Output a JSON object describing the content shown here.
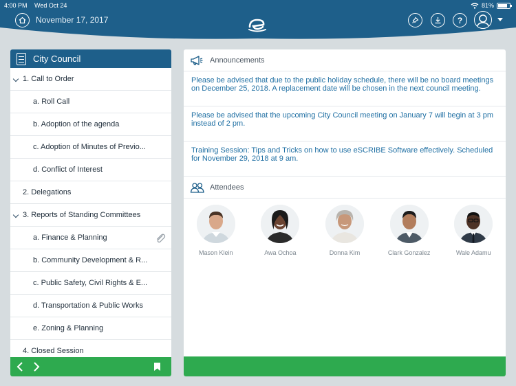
{
  "status_bar": {
    "time": "4:00 PM",
    "day": "Wed Oct 24",
    "battery": "81%"
  },
  "header": {
    "date": "November 17, 2017"
  },
  "agenda": {
    "title": "City Council",
    "items": [
      {
        "label": "1. Call to Order"
      },
      {
        "label": "a. Roll Call"
      },
      {
        "label": "b. Adoption of the agenda"
      },
      {
        "label": "c. Adoption of Minutes of Previo..."
      },
      {
        "label": "d. Conflict of Interest"
      },
      {
        "label": "2. Delegations"
      },
      {
        "label": "3. Reports of Standing Committees"
      },
      {
        "label": "a. Finance & Planning"
      },
      {
        "label": "b. Community Development & R..."
      },
      {
        "label": "c. Public Safety, Civil Rights & E..."
      },
      {
        "label": "d. Transportation & Public Works"
      },
      {
        "label": "e. Zoning & Planning"
      },
      {
        "label": "4. Closed Session"
      }
    ]
  },
  "announcements": {
    "title": "Announcements",
    "items": [
      {
        "text": "Please be advised that due to the public holiday schedule, there will be no board meetings on December 25, 2018. A replacement date will be chosen in the next council meeting."
      },
      {
        "text": "Please be advised that the upcoming City Council meeting on January 7 will begin at 3 pm instead of 2 pm."
      },
      {
        "text": "Training Session: Tips and Tricks on how to use eSCRIBE Software effectively. Scheduled for November 29, 2018 at 9 am."
      }
    ]
  },
  "attendees": {
    "title": "Attendees",
    "people": [
      {
        "name": "Mason Klein"
      },
      {
        "name": "Awa Ochoa"
      },
      {
        "name": "Donna Kim"
      },
      {
        "name": "Clark Gonzalez"
      },
      {
        "name": "Wale Adamu"
      }
    ]
  },
  "colors": {
    "header": "#1e5f8a",
    "accent": "#2eaa4f",
    "link": "#1f6fa3"
  }
}
